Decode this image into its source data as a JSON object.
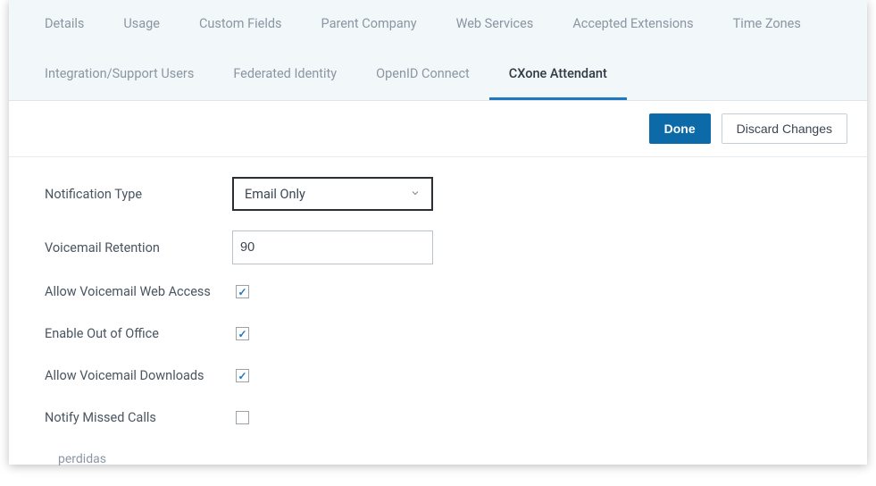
{
  "tabs": {
    "row1": [
      "Details",
      "Usage",
      "Custom Fields",
      "Parent Company",
      "Web Services",
      "Accepted Extensions",
      "Time Zones"
    ],
    "row2": [
      "Integration/Support Users",
      "Federated Identity",
      "OpenID Connect",
      "CXone Attendant"
    ],
    "activeIndex": 3
  },
  "actions": {
    "done": "Done",
    "discard": "Discard Changes"
  },
  "form": {
    "notificationType": {
      "label": "Notification Type",
      "value": "Email Only"
    },
    "voicemailRetention": {
      "label": "Voicemail Retention",
      "value": "90"
    },
    "allowWebAccess": {
      "label": "Allow Voicemail Web Access",
      "checked": true
    },
    "enableOutOfOffice": {
      "label": "Enable Out of Office",
      "checked": true
    },
    "allowDownloads": {
      "label": "Allow Voicemail Downloads",
      "checked": true
    },
    "notifyMissed": {
      "label": "Notify Missed Calls",
      "checked": false
    }
  },
  "cutoff": "perdidas"
}
